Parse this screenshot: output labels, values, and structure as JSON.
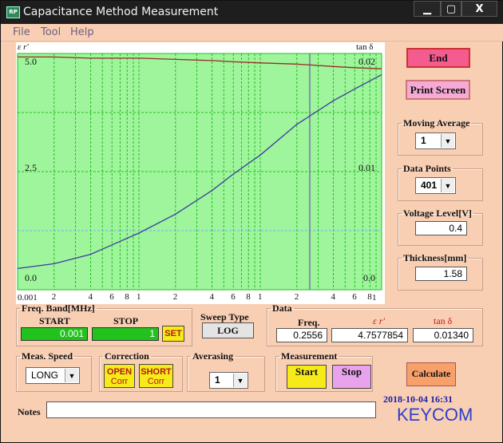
{
  "window": {
    "title": "Capacitance Method Measurement",
    "icon_text": "RP",
    "buttons": {
      "minimize": "▁",
      "maximize": "▢",
      "close": "X"
    }
  },
  "menu": [
    "File",
    "Tool",
    "Help"
  ],
  "plot": {
    "left_axis_label": "ε r'",
    "right_axis_label": "tan δ",
    "y_left_ticks": [
      "5.0",
      "2.5",
      "0.0"
    ],
    "y_right_ticks": [
      "0.02",
      "0.01",
      "0.0"
    ],
    "x_start_label": "0.001",
    "x_end_label": "1",
    "x_minor_labels": [
      "2",
      "4",
      "6",
      "8",
      "1",
      "2",
      "4",
      "6",
      "8",
      "1",
      "2",
      "4",
      "6",
      "8"
    ],
    "background_color": "#9ef59b",
    "grid_color": "#21c21b",
    "eps_line_color": "#3f3aa2",
    "tan_line_color": "#9b2a2a",
    "cursor_color": "#7a73b5"
  },
  "chart_data": {
    "type": "line",
    "x_scale": "log",
    "xlim": [
      0.001,
      1
    ],
    "ylim_left": [
      0,
      5.0
    ],
    "ylim_right": [
      0,
      0.02
    ],
    "x": [
      0.001,
      0.002,
      0.004,
      0.006,
      0.01,
      0.02,
      0.04,
      0.06,
      0.1,
      0.2,
      0.4,
      0.6,
      1
    ],
    "series": [
      {
        "axis": "left",
        "values": [
          0.45,
          0.55,
          0.75,
          0.95,
          1.2,
          1.6,
          2.1,
          2.45,
          2.85,
          3.5,
          4.0,
          4.25,
          4.55
        ]
      },
      {
        "axis": "right",
        "values": [
          0.0197,
          0.0197,
          0.0196,
          0.0196,
          0.0196,
          0.0195,
          0.0194,
          0.0193,
          0.0192,
          0.0191,
          0.0189,
          0.0188,
          0.0187
        ]
      }
    ],
    "cursor_x": 0.2556
  },
  "buttons": {
    "end": "End",
    "print_screen": "Print Screen",
    "set": "SET",
    "log": "LOG",
    "open_corr_1": "OPEN",
    "open_corr_2": "Corr",
    "short_corr_1": "SHORT",
    "short_corr_2": "Corr",
    "start": "Start",
    "stop": "Stop",
    "calculate": "Calculate"
  },
  "moving_average": {
    "label": "Moving Average",
    "value": "1"
  },
  "data_points": {
    "label": "Data Points",
    "value": "401"
  },
  "voltage_level": {
    "label": "Voltage Level[V]",
    "value": "0.4"
  },
  "thickness": {
    "label": "Thickness[mm]",
    "value": "1.58"
  },
  "freq_band": {
    "label": "Freq. Band[MHz]",
    "start_label": "START",
    "stop_label": "STOP",
    "start_value": "0.001",
    "stop_value": "1"
  },
  "sweep_type": {
    "label": "Sweep Type"
  },
  "data_panel": {
    "label": "Data",
    "freq_label": "Freq.",
    "eps_label": "ε r'",
    "tan_label": "tan δ",
    "freq_value": "0.2556",
    "eps_value": "4.7577854",
    "tan_value": "0.01340"
  },
  "meas_speed": {
    "label": "Meas. Speed",
    "value": "LONG"
  },
  "correction": {
    "label": "Correction"
  },
  "averaging": {
    "label": "Averasing",
    "value": "1"
  },
  "measurement": {
    "label": "Measurement"
  },
  "timestamp": "2018-10-04 16:31",
  "brand": "KEYCOM",
  "notes": {
    "label": "Notes",
    "value": ""
  }
}
